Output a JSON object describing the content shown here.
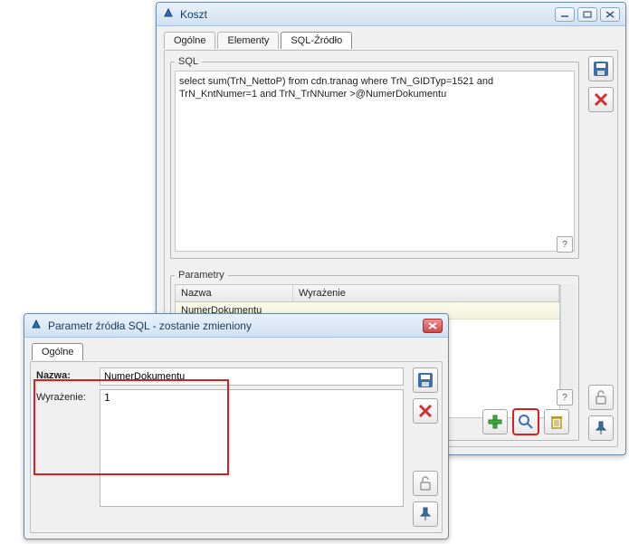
{
  "mainWindow": {
    "title": "Koszt",
    "tabs": [
      "Ogólne",
      "Elementy",
      "SQL-Źródło"
    ],
    "activeTab": 2,
    "sqlGroup": {
      "label": "SQL",
      "text": "select sum(TrN_NettoP) from cdn.tranag where TrN_GIDTyp=1521 and TrN_KntNumer=1 and TrN_TrNNumer >@NumerDokumentu"
    },
    "paramGroup": {
      "label": "Parametry",
      "columns": {
        "name": "Nazwa",
        "expr": "Wyrażenie"
      },
      "rows": [
        {
          "name": "NumerDokumentu",
          "expr": ""
        }
      ]
    },
    "help": "?"
  },
  "dialog": {
    "title": "Parametr źródła SQL - zostanie zmieniony",
    "tab": "Ogólne",
    "fields": {
      "nameLabel": "Nazwa:",
      "nameValue": "NumerDokumentu",
      "exprLabel": "Wyrażenie:",
      "exprValue": "1"
    }
  },
  "icons": {
    "save": "save-icon",
    "delete": "delete-icon",
    "add": "add-icon",
    "search": "search-icon",
    "trash": "trash-icon",
    "unlock": "unlock-icon",
    "pin": "pin-icon",
    "min": "minimize-icon",
    "max": "maximize-icon",
    "close": "close-icon",
    "help": "help-icon",
    "app": "app-icon"
  },
  "colors": {
    "accent": "#4a7dbb",
    "danger": "#d92020",
    "green": "#3fae3f"
  }
}
